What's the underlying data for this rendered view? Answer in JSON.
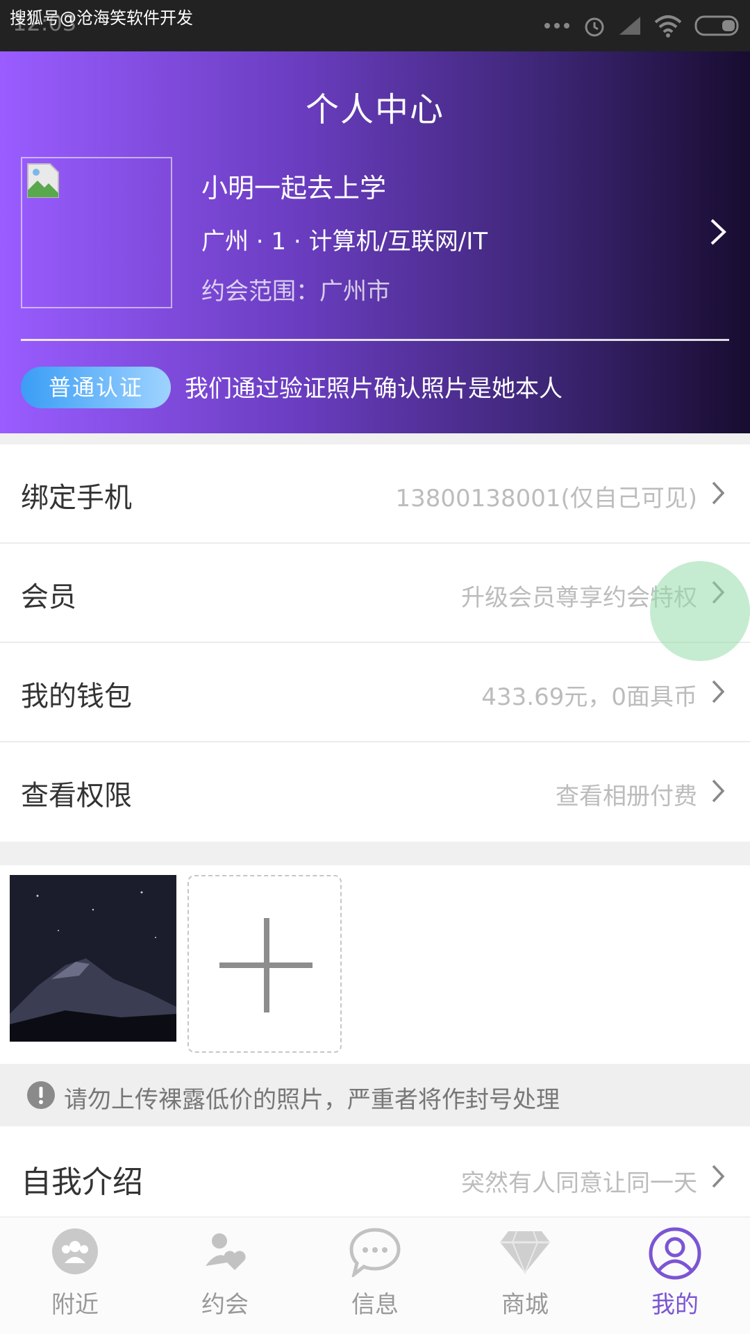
{
  "status_bar": {
    "time": "12:03",
    "watermark": "搜狐号@沧海笑软件开发",
    "icons": [
      "more-dots-icon",
      "alarm-icon",
      "signal-icon",
      "wifi-icon",
      "battery-icon"
    ]
  },
  "header": {
    "title": "个人中心",
    "profile": {
      "name": "小明一起去上学",
      "info": "广州 · 1 · 计算机/互联网/IT",
      "date_range": "约会范围：广州市"
    },
    "certification": {
      "badge": "普通认证",
      "text": "我们通过验证照片确认照片是她本人"
    }
  },
  "settings": [
    {
      "label": "绑定手机",
      "value": "13800138001(仅自己可见)"
    },
    {
      "label": "会员",
      "value": "升级会员尊享约会特权"
    },
    {
      "label": "我的钱包",
      "value": "433.69元，0面具币"
    },
    {
      "label": "查看权限",
      "value": "查看相册付费"
    }
  ],
  "notice": "请勿上传裸露低价的照片，严重者将作封号处理",
  "intro": {
    "label": "自我介绍",
    "value": "突然有人同意让同一天"
  },
  "tabs": [
    {
      "label": "附近",
      "icon": "nearby-people-icon",
      "active": false
    },
    {
      "label": "约会",
      "icon": "dating-hearts-icon",
      "active": false
    },
    {
      "label": "信息",
      "icon": "message-bubble-icon",
      "active": false
    },
    {
      "label": "商城",
      "icon": "diamond-shop-icon",
      "active": false
    },
    {
      "label": "我的",
      "icon": "profile-user-icon",
      "active": true
    }
  ],
  "colors": {
    "header_gradient_start": "#9a5cff",
    "header_gradient_end": "#180c30",
    "badge_blue": "#3a9df5",
    "active_tab": "#7b55d4"
  }
}
